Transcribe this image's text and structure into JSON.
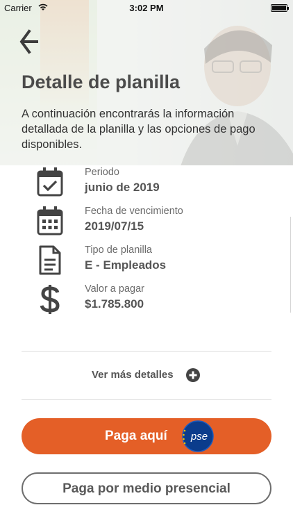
{
  "status_bar": {
    "carrier": "Carrier",
    "time": "3:02 PM",
    "icons": [
      "wifi-icon",
      "battery-icon"
    ]
  },
  "header": {
    "back_icon": "arrow-left-icon",
    "title": "Detalle de planilla",
    "description": "A continuación encontrarás la información detallada de la planilla y las opciones de pago disponibles."
  },
  "details": [
    {
      "icon": "calendar-check-icon",
      "label": "Periodo",
      "value": "junio de 2019"
    },
    {
      "icon": "calendar-grid-icon",
      "label": "Fecha de vencimiento",
      "value": "2019/07/15"
    },
    {
      "icon": "document-icon",
      "label": "Tipo de planilla",
      "value": "E - Empleados"
    },
    {
      "icon": "dollar-icon",
      "label": "Valor a pagar",
      "value": "$1.785.800"
    }
  ],
  "more_details": {
    "label": "Ver más detalles",
    "icon": "plus-circle-icon"
  },
  "actions": {
    "pay_online": {
      "label": "Paga aquí",
      "logo_text": "pse"
    },
    "pay_in_person": {
      "label": "Paga por medio presencial"
    }
  },
  "colors": {
    "accent": "#e45f27",
    "text_dark": "#4b4b4b",
    "pse_blue": "#0b3c8c"
  }
}
